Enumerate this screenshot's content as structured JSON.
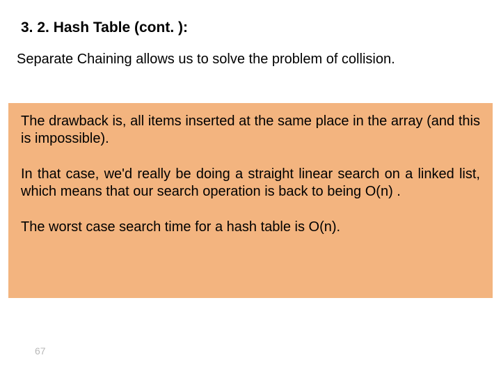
{
  "slide": {
    "title": "3. 2. Hash Table (cont. ):",
    "intro": "Separate Chaining allows us to solve the problem of collision.",
    "box": {
      "p1": "The drawback is, all items inserted at the same place in the array (and this is impossible).",
      "p2": "In that case, we'd really be doing a straight linear search on a linked list, which means that our search operation is back to being O(n) .",
      "p3": "The worst case search time for a hash table is O(n)."
    },
    "page": "67"
  }
}
